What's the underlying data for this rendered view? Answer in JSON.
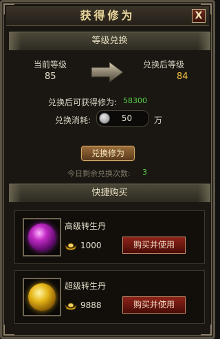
{
  "window": {
    "title": "获得修为",
    "close_label": "X"
  },
  "exchange_section": {
    "header": "等级兑换",
    "current_level_label": "当前等级",
    "current_level": "85",
    "new_level_label": "兑换后等级",
    "new_level": "84",
    "gain_label": "兑换后可获得修为:",
    "gain_value": "58300",
    "cost_label": "兑换消耗:",
    "cost_value": "50",
    "cost_unit": "万",
    "exchange_button": "兑换修为",
    "remaining_label": "今日剩余兑换次数:",
    "remaining_value": "3"
  },
  "quick_buy": {
    "header": "快捷购买",
    "items": [
      {
        "name": "高级转生丹",
        "price": "1000",
        "buy_label": "购买并使用",
        "orb_color": "#c12ac4"
      },
      {
        "name": "超级转生丹",
        "price": "9888",
        "buy_label": "购买并使用",
        "orb_color": "#e6b618"
      }
    ]
  },
  "colors": {
    "accent_green": "#58d448",
    "level_gold": "#f0c040"
  }
}
